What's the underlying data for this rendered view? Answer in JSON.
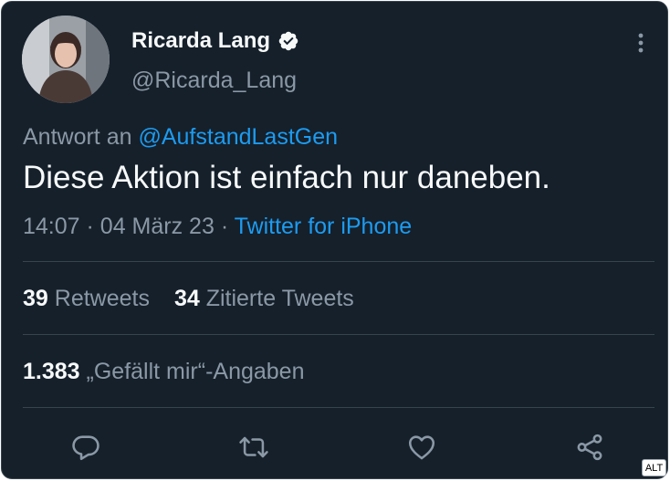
{
  "author": {
    "display_name": "Ricarda Lang",
    "handle": "@Ricarda_Lang",
    "verified": true
  },
  "reply": {
    "prefix": "Antwort an",
    "mention": "@AufstandLastGen"
  },
  "tweet": {
    "text": "Diese Aktion ist einfach nur daneben.",
    "time": "14:07",
    "separator": "·",
    "date": "04 März 23",
    "source": "Twitter for iPhone"
  },
  "stats": {
    "retweets_count": "39",
    "retweets_label": "Retweets",
    "quotes_count": "34",
    "quotes_label": "Zitierte Tweets",
    "likes_count": "1.383",
    "likes_label": "„Gefällt mir“-Angaben"
  },
  "actions": {
    "icons": [
      "reply-icon",
      "retweet-icon",
      "like-icon",
      "share-icon"
    ]
  },
  "badge": {
    "alt_label": "ALT"
  },
  "colors": {
    "background": "#15202b",
    "border": "#38444d",
    "primary_text": "#f7f9f9",
    "secondary_text": "#8b98a5",
    "accent": "#1d9bf0"
  }
}
